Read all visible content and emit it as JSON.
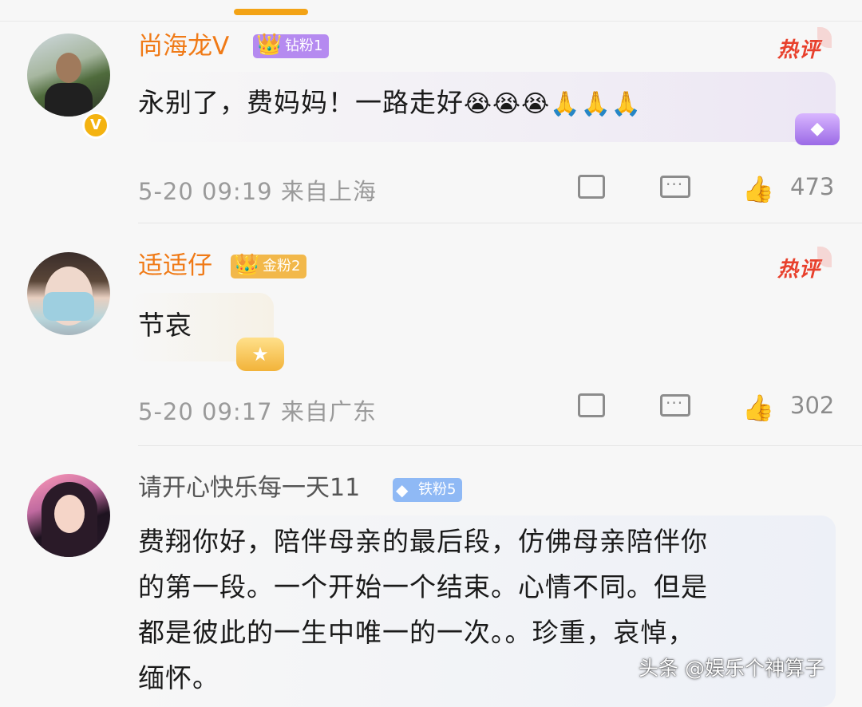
{
  "comments": [
    {
      "username": "尚海龙V",
      "fan_badge": "钻粉1",
      "hot_tag": "热评",
      "text": "永别了，费妈妈！一路走好",
      "emojis_cry": "😭😭😭",
      "emojis_pray": "🙏🙏🙏",
      "time": "5-20 09:19",
      "location": "来自上海",
      "likes": "473"
    },
    {
      "username": "适适仔",
      "fan_badge": "金粉2",
      "hot_tag": "热评",
      "text": "节哀",
      "time": "5-20 09:17",
      "location": "来自广东",
      "likes": "302"
    },
    {
      "username": "请开心快乐每一天11",
      "fan_badge": "铁粉5",
      "lines": [
        "费翔你好，陪伴母亲的最后段，仿佛母亲陪伴你",
        "的第一段。一个开始一个结束。心情不同。但是",
        "都是彼此的一生中唯一的一次。。珍重，哀悼，",
        "缅怀。"
      ]
    }
  ],
  "watermark": "头条 @娱乐个神算子",
  "icons": {
    "share": "share-icon",
    "comment": "comment-icon",
    "like": "thumbs-up-icon",
    "verified": "verified-badge-icon",
    "crown": "crown-icon",
    "diamond": "diamond-icon"
  },
  "colors": {
    "username_orange": "#f07a16",
    "hot_red": "#e8402c",
    "meta_gray": "#9a9a9a",
    "accent_top": "#f3a316"
  }
}
